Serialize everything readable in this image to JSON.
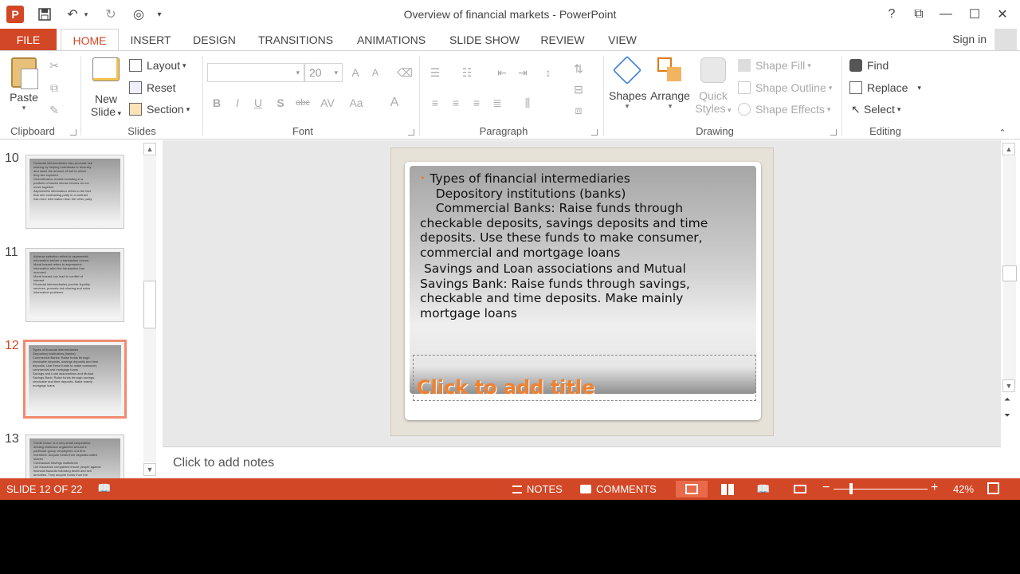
{
  "app": {
    "window_title": "Overview of financial markets - PowerPoint",
    "logo_letter": "P",
    "brand_color": "#d24726"
  },
  "window_controls": {
    "help": "?",
    "restore_ribbon": "⧉",
    "minimize": "—",
    "maximize": "☐",
    "close": "✕"
  },
  "tabs": [
    "FILE",
    "HOME",
    "INSERT",
    "DESIGN",
    "TRANSITIONS",
    "ANIMATIONS",
    "SLIDE SHOW",
    "REVIEW",
    "VIEW"
  ],
  "active_tab": "HOME",
  "sign_in": "Sign in",
  "ribbon": {
    "clipboard": {
      "label": "Clipboard",
      "paste": "Paste"
    },
    "slides": {
      "label": "Slides",
      "new_slide_1": "New",
      "new_slide_2": "Slide",
      "layout": "Layout",
      "reset": "Reset",
      "section": "Section"
    },
    "font": {
      "label": "Font",
      "font_size": "20",
      "bold": "B",
      "italic": "I",
      "underline": "U",
      "shadow": "S",
      "strike": "abc",
      "spacing": "AV",
      "case": "Aa",
      "color": "A",
      "grow": "A",
      "shrink": "A"
    },
    "paragraph": {
      "label": "Paragraph"
    },
    "drawing": {
      "label": "Drawing",
      "shapes": "Shapes",
      "arrange": "Arrange",
      "quick_styles_1": "Quick",
      "quick_styles_2": "Styles",
      "shape_fill": "Shape Fill",
      "shape_outline": "Shape Outline",
      "shape_effects": "Shape Effects"
    },
    "editing": {
      "label": "Editing",
      "find": "Find",
      "replace": "Replace",
      "select": "Select"
    }
  },
  "thumbnails": [
    {
      "number": "10",
      "lines": [
        "Financial intermediaries also promote risk",
        "sharing by helping individuals to diversify",
        "and lower the amount of risk to which",
        "they are exposed",
        "Diversification entails investing in a",
        "portfolio of stocks whose returns do not",
        "move together",
        "Asymmetric information refers to the fact",
        "that one contracting party in a contract",
        "has more information than the other party"
      ]
    },
    {
      "number": "11",
      "lines": [
        "Adverse selection refers to asymmetric",
        "information before a transaction occurs",
        "Moral hazard refers to asymmetric",
        "information after the transaction has",
        "occurred",
        "Moral hazard can lead to conflict of",
        "interest",
        "Financial intermediaries provide liquidity",
        "services, promote risk sharing and solve",
        "information problems"
      ]
    },
    {
      "number": "12",
      "lines": [
        "Types of financial intermediaries",
        "Depository institutions (banks)",
        "Commercial Banks: Raise funds through",
        "checkable deposits, savings deposits and time",
        "deposits. Use these funds to make consumer,",
        "commercial and mortgage loans",
        "Savings and Loan associations and Mutual",
        "Savings Bank: Raise funds through savings,",
        "checkable and time deposits. Make mainly",
        "mortgage loans"
      ]
    },
    {
      "number": "13",
      "lines": [
        "Credit Union: is a very small cooperative",
        "lending institution organized around a",
        "particular group: employees of a firm",
        "members. Acquire funds from deposits called",
        "shares",
        "Contractual Savings institutions",
        "Life insurance companies insure people against",
        "financial hazards following death and sell",
        "annuities. They acquire funds from the"
      ]
    }
  ],
  "selected_slide": "12",
  "slide": {
    "body_lines": [
      "Types of financial intermediaries",
      "    Depository institutions (banks)",
      "    Commercial Banks: Raise funds through",
      "checkable deposits, savings deposits and time",
      "deposits. Use these funds to make consumer,",
      "commercial and mortgage loans",
      " Savings and Loan associations and Mutual",
      "Savings Bank: Raise funds through savings,",
      "checkable and time deposits. Make mainly",
      "mortgage loans"
    ],
    "bullet": "•",
    "title_placeholder": "Click to add title",
    "title_color": "#f0812e"
  },
  "notes_placeholder": "Click to add notes",
  "status": {
    "slide_indicator": "SLIDE 12 OF 22",
    "notes": "NOTES",
    "comments": "COMMENTS",
    "zoom_minus": "−",
    "zoom_plus": "+",
    "zoom": "42%"
  }
}
